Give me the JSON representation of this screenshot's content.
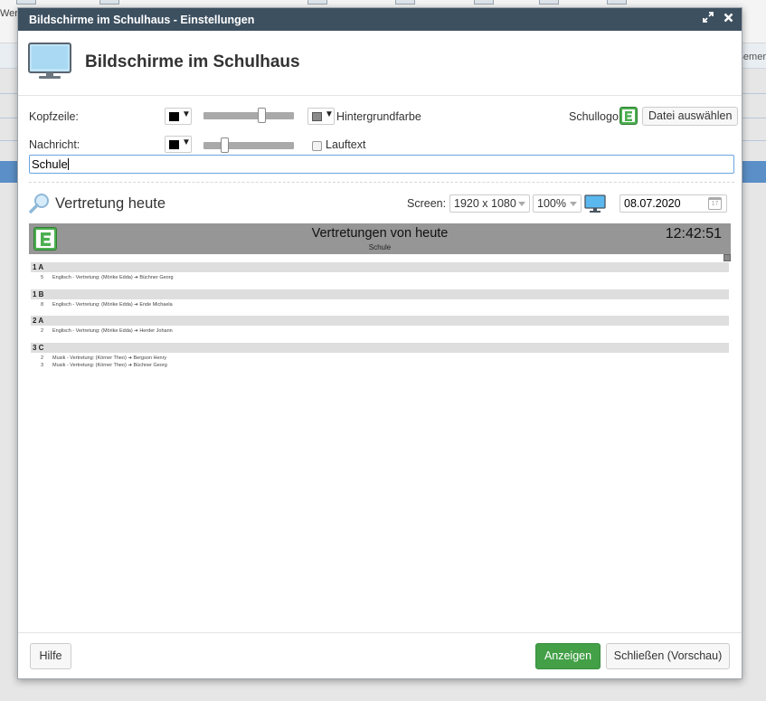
{
  "background": {
    "left_text": "Wer",
    "right_text": "Bemer"
  },
  "dialog": {
    "window_title": "Bildschirme im Schulhaus - Einstellungen",
    "heading": "Bildschirme im Schulhaus",
    "icons": [
      "monitor-icon",
      "expand-icon",
      "close-icon"
    ]
  },
  "settings": {
    "kopfzeile_label": "Kopfzeile:",
    "kopfzeile_color": "#000000",
    "kopfzeile_slider_value": 0.65,
    "hintergrund_color": "#8a8a8a",
    "hintergrund_label": "Hintergrundfarbe",
    "schullogo_label": "Schullogo:",
    "file_button": "Datei auswählen",
    "nachricht_label": "Nachricht:",
    "nachricht_color": "#000000",
    "nachricht_slider_value": 0.23,
    "lauftext_label": "Lauftext",
    "lauftext_checked": false,
    "message_value": "Schule"
  },
  "preview_controls": {
    "title": "Vertretung heute",
    "screen_label": "Screen:",
    "resolution": "1920 x 1080",
    "zoom": "100%",
    "date": "08.07.2020"
  },
  "preview": {
    "title": "Vertretungen von heute",
    "subtitle": "Schule",
    "time": "12:42:51",
    "classes": [
      {
        "name": "1 A",
        "entries": [
          {
            "lesson": "5",
            "text": "Englisch - Vertretung: (Mörike Edda) ➔ Büchner Georg"
          }
        ]
      },
      {
        "name": "1 B",
        "entries": [
          {
            "lesson": "8",
            "text": "Englisch - Vertretung: (Mörike Edda) ➔ Ende Michaela"
          }
        ]
      },
      {
        "name": "2 A",
        "entries": [
          {
            "lesson": "2",
            "text": "Englisch - Vertretung: (Mörike Edda) ➔ Herder Johann"
          }
        ]
      },
      {
        "name": "3 C",
        "entries": [
          {
            "lesson": "2",
            "text": "Musik - Vertretung: (Körner Theo) ➔ Bergson Henry"
          },
          {
            "lesson": "3",
            "text": "Musik - Vertretung: (Körner Theo) ➔ Büchner Georg"
          }
        ]
      }
    ]
  },
  "footer": {
    "help_button": "Hilfe",
    "show_button": "Anzeigen",
    "close_button": "Schließen (Vorschau)"
  },
  "colors": {
    "titlebar": "#3d5060",
    "primary_green": "#43a047",
    "preview_header": "#969696",
    "focus_border": "#6ba5e0"
  }
}
